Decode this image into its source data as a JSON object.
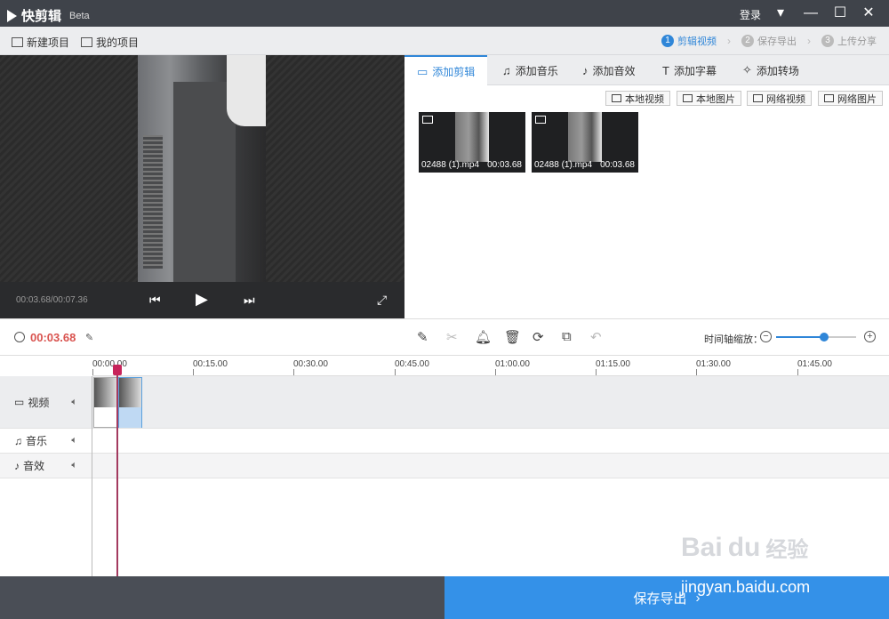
{
  "titlebar": {
    "app_name": "快剪辑",
    "beta": "Beta",
    "login": "登录"
  },
  "toolbar": {
    "new_project": "新建项目",
    "my_projects": "我的项目",
    "steps": [
      {
        "num": "1",
        "label": "剪辑视频"
      },
      {
        "num": "2",
        "label": "保存导出"
      },
      {
        "num": "3",
        "label": "上传分享"
      }
    ]
  },
  "preview": {
    "time": "00:03.68/00:07.36"
  },
  "tabs": [
    {
      "label": "添加剪辑",
      "icon": "video-camera-icon"
    },
    {
      "label": "添加音乐",
      "icon": "music-note-icon"
    },
    {
      "label": "添加音效",
      "icon": "sound-effect-icon"
    },
    {
      "label": "添加字幕",
      "icon": "text-icon"
    },
    {
      "label": "添加转场",
      "icon": "magic-wand-icon"
    }
  ],
  "source_buttons": [
    {
      "label": "本地视频"
    },
    {
      "label": "本地图片"
    },
    {
      "label": "网络视频"
    },
    {
      "label": "网络图片"
    }
  ],
  "clips": [
    {
      "name": "02488 (1).mp4",
      "duration": "00:03.68"
    },
    {
      "name": "02488 (1).mp4",
      "duration": "00:03.68"
    }
  ],
  "edit": {
    "current_time": "00:03.68",
    "zoom_label": "时间轴缩放：",
    "zoom_level": 0.6
  },
  "ruler": [
    "00:00.00",
    "00:15.00",
    "00:30.00",
    "00:45.00",
    "01:00.00",
    "01:15.00",
    "01:30.00",
    "01:45.00"
  ],
  "tracks": [
    {
      "label": "视频"
    },
    {
      "label": "音乐"
    },
    {
      "label": "音效"
    }
  ],
  "footer": {
    "export": "保存导出"
  },
  "watermark": {
    "logo_text": "Bai",
    "logo_text2": "du",
    "logo_cn": "经验",
    "url": "jingyan.baidu.com"
  },
  "colors": {
    "accent": "#2f86d8",
    "time_red": "#d9534f",
    "export_blue": "#3491e8"
  }
}
